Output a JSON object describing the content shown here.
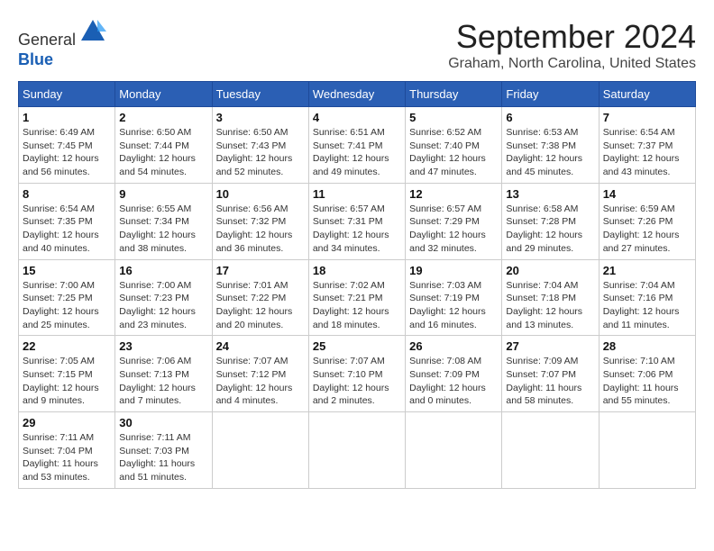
{
  "header": {
    "logo_line1": "General",
    "logo_line2": "Blue",
    "month_title": "September 2024",
    "location": "Graham, North Carolina, United States"
  },
  "days_of_week": [
    "Sunday",
    "Monday",
    "Tuesday",
    "Wednesday",
    "Thursday",
    "Friday",
    "Saturday"
  ],
  "weeks": [
    [
      {
        "num": "1",
        "sunrise": "6:49 AM",
        "sunset": "7:45 PM",
        "daylight": "12 hours and 56 minutes."
      },
      {
        "num": "2",
        "sunrise": "6:50 AM",
        "sunset": "7:44 PM",
        "daylight": "12 hours and 54 minutes."
      },
      {
        "num": "3",
        "sunrise": "6:50 AM",
        "sunset": "7:43 PM",
        "daylight": "12 hours and 52 minutes."
      },
      {
        "num": "4",
        "sunrise": "6:51 AM",
        "sunset": "7:41 PM",
        "daylight": "12 hours and 49 minutes."
      },
      {
        "num": "5",
        "sunrise": "6:52 AM",
        "sunset": "7:40 PM",
        "daylight": "12 hours and 47 minutes."
      },
      {
        "num": "6",
        "sunrise": "6:53 AM",
        "sunset": "7:38 PM",
        "daylight": "12 hours and 45 minutes."
      },
      {
        "num": "7",
        "sunrise": "6:54 AM",
        "sunset": "7:37 PM",
        "daylight": "12 hours and 43 minutes."
      }
    ],
    [
      {
        "num": "8",
        "sunrise": "6:54 AM",
        "sunset": "7:35 PM",
        "daylight": "12 hours and 40 minutes."
      },
      {
        "num": "9",
        "sunrise": "6:55 AM",
        "sunset": "7:34 PM",
        "daylight": "12 hours and 38 minutes."
      },
      {
        "num": "10",
        "sunrise": "6:56 AM",
        "sunset": "7:32 PM",
        "daylight": "12 hours and 36 minutes."
      },
      {
        "num": "11",
        "sunrise": "6:57 AM",
        "sunset": "7:31 PM",
        "daylight": "12 hours and 34 minutes."
      },
      {
        "num": "12",
        "sunrise": "6:57 AM",
        "sunset": "7:29 PM",
        "daylight": "12 hours and 32 minutes."
      },
      {
        "num": "13",
        "sunrise": "6:58 AM",
        "sunset": "7:28 PM",
        "daylight": "12 hours and 29 minutes."
      },
      {
        "num": "14",
        "sunrise": "6:59 AM",
        "sunset": "7:26 PM",
        "daylight": "12 hours and 27 minutes."
      }
    ],
    [
      {
        "num": "15",
        "sunrise": "7:00 AM",
        "sunset": "7:25 PM",
        "daylight": "12 hours and 25 minutes."
      },
      {
        "num": "16",
        "sunrise": "7:00 AM",
        "sunset": "7:23 PM",
        "daylight": "12 hours and 23 minutes."
      },
      {
        "num": "17",
        "sunrise": "7:01 AM",
        "sunset": "7:22 PM",
        "daylight": "12 hours and 20 minutes."
      },
      {
        "num": "18",
        "sunrise": "7:02 AM",
        "sunset": "7:21 PM",
        "daylight": "12 hours and 18 minutes."
      },
      {
        "num": "19",
        "sunrise": "7:03 AM",
        "sunset": "7:19 PM",
        "daylight": "12 hours and 16 minutes."
      },
      {
        "num": "20",
        "sunrise": "7:04 AM",
        "sunset": "7:18 PM",
        "daylight": "12 hours and 13 minutes."
      },
      {
        "num": "21",
        "sunrise": "7:04 AM",
        "sunset": "7:16 PM",
        "daylight": "12 hours and 11 minutes."
      }
    ],
    [
      {
        "num": "22",
        "sunrise": "7:05 AM",
        "sunset": "7:15 PM",
        "daylight": "12 hours and 9 minutes."
      },
      {
        "num": "23",
        "sunrise": "7:06 AM",
        "sunset": "7:13 PM",
        "daylight": "12 hours and 7 minutes."
      },
      {
        "num": "24",
        "sunrise": "7:07 AM",
        "sunset": "7:12 PM",
        "daylight": "12 hours and 4 minutes."
      },
      {
        "num": "25",
        "sunrise": "7:07 AM",
        "sunset": "7:10 PM",
        "daylight": "12 hours and 2 minutes."
      },
      {
        "num": "26",
        "sunrise": "7:08 AM",
        "sunset": "7:09 PM",
        "daylight": "12 hours and 0 minutes."
      },
      {
        "num": "27",
        "sunrise": "7:09 AM",
        "sunset": "7:07 PM",
        "daylight": "11 hours and 58 minutes."
      },
      {
        "num": "28",
        "sunrise": "7:10 AM",
        "sunset": "7:06 PM",
        "daylight": "11 hours and 55 minutes."
      }
    ],
    [
      {
        "num": "29",
        "sunrise": "7:11 AM",
        "sunset": "7:04 PM",
        "daylight": "11 hours and 53 minutes."
      },
      {
        "num": "30",
        "sunrise": "7:11 AM",
        "sunset": "7:03 PM",
        "daylight": "11 hours and 51 minutes."
      },
      null,
      null,
      null,
      null,
      null
    ]
  ]
}
